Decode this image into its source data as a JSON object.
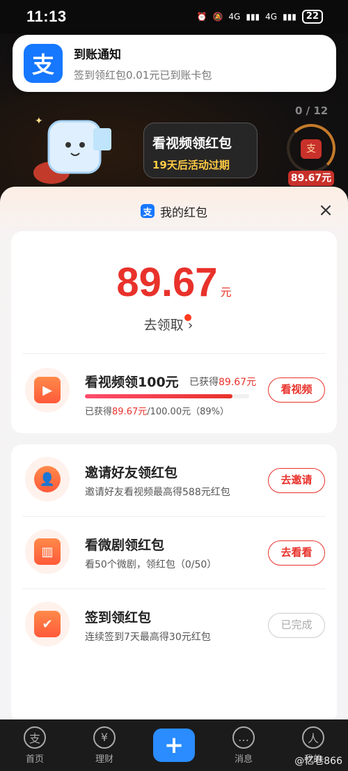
{
  "status_bar": {
    "time": "11:13",
    "network1": "4G",
    "network2": "4G",
    "battery": "22"
  },
  "notification": {
    "app_icon_char": "支",
    "title": "到账通知",
    "body": "签到领红包0.01元已到账卡包"
  },
  "promo": {
    "title": "看视频领红包",
    "subtitle": "19天后活动过期",
    "counter": "0 / 12",
    "redpacket_char": "支",
    "amount": "89.67元"
  },
  "sheet": {
    "logo_char": "支",
    "title": "我的红包",
    "close_icon": "×",
    "balance": {
      "amount": "89.67",
      "unit": "元",
      "claim_label": "去领取",
      "claim_arrow": "›"
    },
    "video_task": {
      "title": "看视频领100元",
      "earned_prefix": "已获得",
      "earned_value": "89.67元",
      "button": "看视频",
      "progress_prefix": "已获得",
      "progress_value": "89.67元",
      "progress_suffix": "/100.00元（89%）",
      "progress_fraction": 0.8967
    },
    "tasks": [
      {
        "title": "邀请好友领红包",
        "desc": "邀请好友看视频最高得588元红包",
        "button": "去邀请",
        "done": false,
        "icon": "person-add-icon"
      },
      {
        "title": "看微剧领红包",
        "desc": "看50个微剧，领红包（0/50）",
        "button": "去看看",
        "done": false,
        "icon": "tv-icon"
      },
      {
        "title": "签到领红包",
        "desc": "连续签到7天最高得30元红包",
        "button": "已完成",
        "done": true,
        "icon": "calendar-check-icon"
      }
    ]
  },
  "bottom_nav": {
    "items": [
      {
        "label": "首页",
        "glyph": "支"
      },
      {
        "label": "理财",
        "glyph": "¥"
      },
      {
        "label": "",
        "glyph": "+"
      },
      {
        "label": "消息",
        "glyph": "…"
      },
      {
        "label": "我的",
        "glyph": "人"
      }
    ]
  },
  "watermark": "@忆巷866",
  "colors": {
    "accent_red": "#e8322b",
    "brand_blue": "#1677ff"
  }
}
